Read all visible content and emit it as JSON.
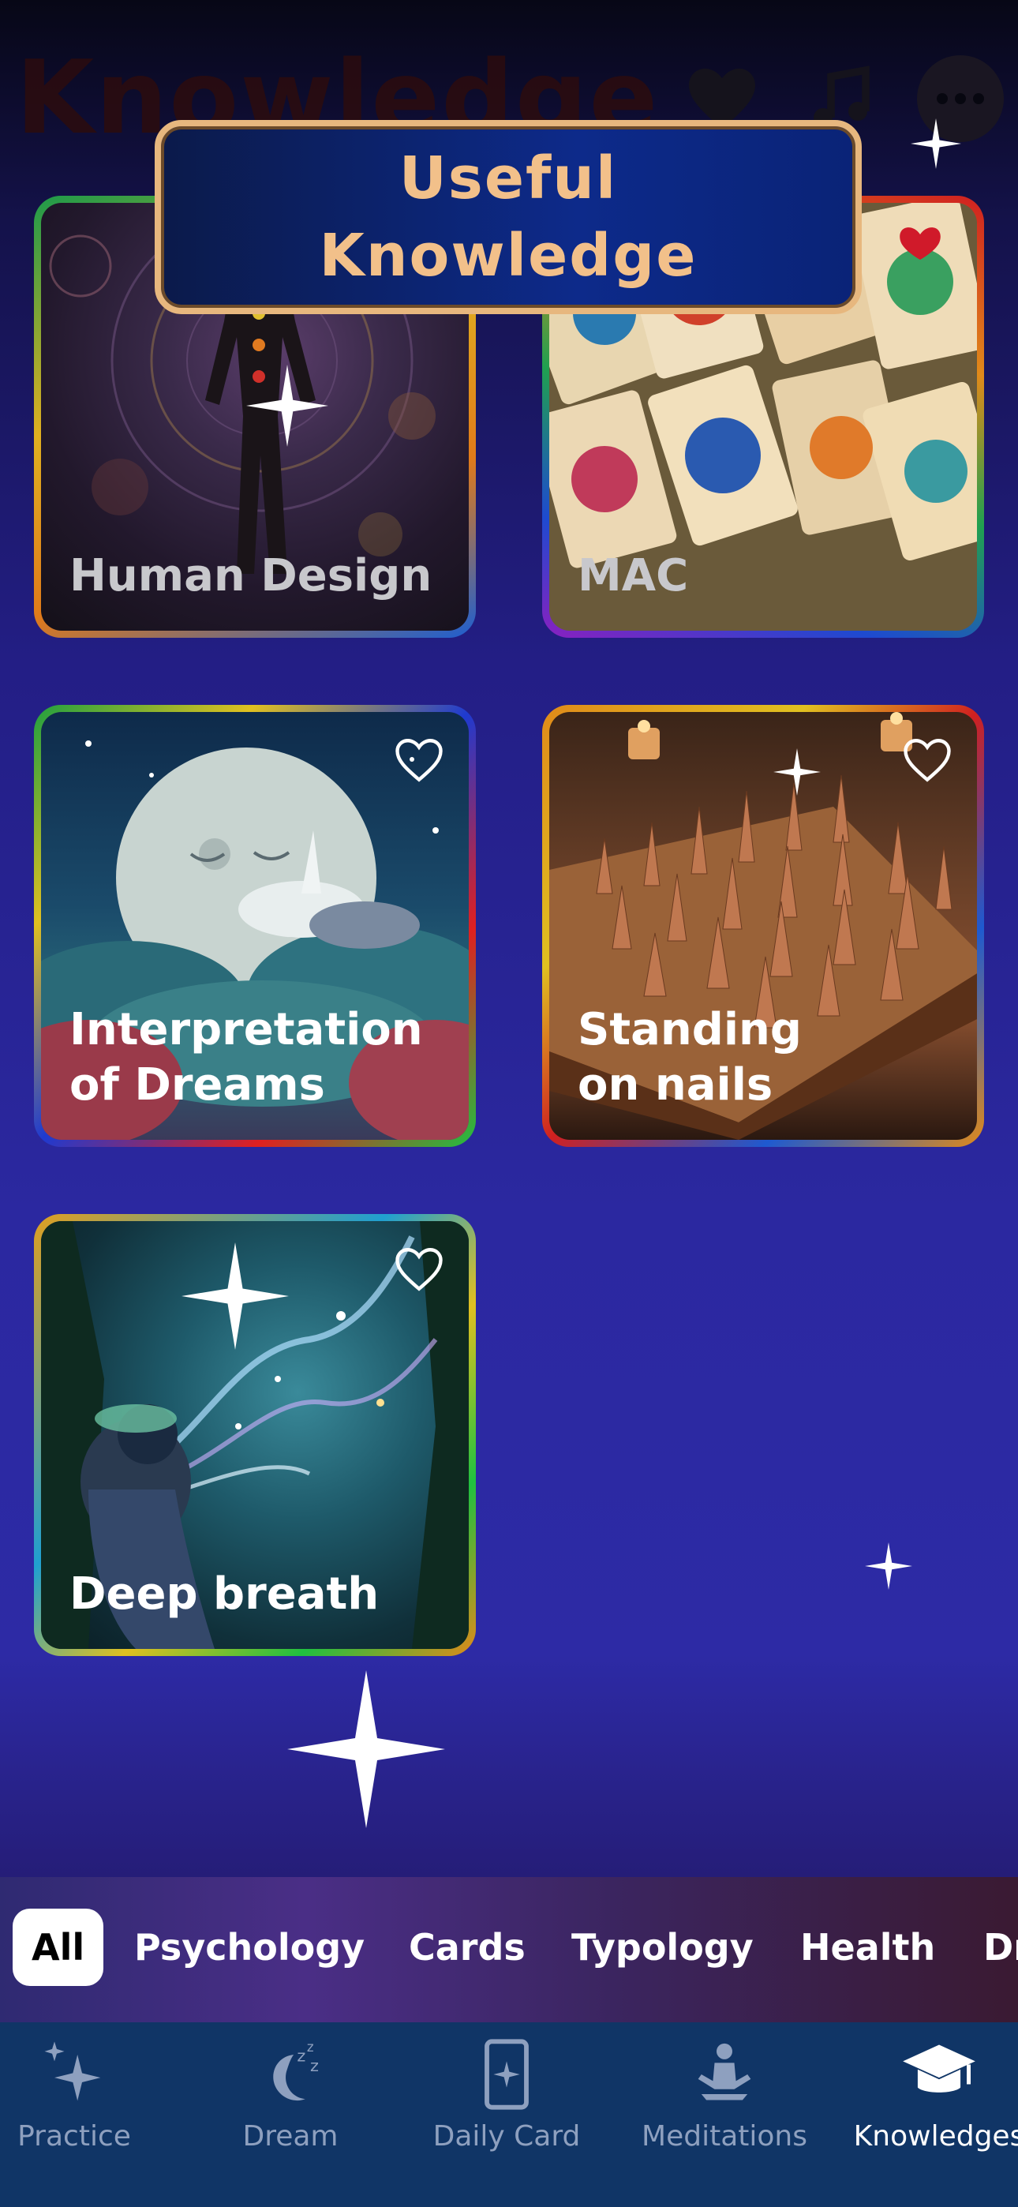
{
  "header": {
    "title": "Knowledge",
    "icons": [
      "heart-icon",
      "music-icon",
      "more-icon"
    ]
  },
  "banner": {
    "line1": "Useful",
    "line2": "Knowledge"
  },
  "cards": [
    {
      "title": "Human Design"
    },
    {
      "title": "MAC"
    },
    {
      "title_line1": "Interpretation",
      "title_line2": "of Dreams"
    },
    {
      "title_line1": "Standing",
      "title_line2": "on nails"
    },
    {
      "title": "Deep breath"
    }
  ],
  "filters": {
    "items": [
      "All",
      "Psychology",
      "Cards",
      "Typology",
      "Health",
      "Dr"
    ],
    "selected": "All"
  },
  "tabs": [
    {
      "label": "Practice",
      "icon": "sparkles-icon"
    },
    {
      "label": "Dream",
      "icon": "moon-icon"
    },
    {
      "label": "Daily Card",
      "icon": "card-icon"
    },
    {
      "label": "Meditations",
      "icon": "meditation-icon"
    },
    {
      "label": "Knowledges",
      "icon": "graduation-cap-icon",
      "active": true
    }
  ],
  "colors": {
    "banner_border": "#e7b77e",
    "banner_text": "#f2c08a",
    "tabbar_bg": "#103566",
    "tab_inactive": "#8ea0bf",
    "tab_active": "#ffffff"
  }
}
